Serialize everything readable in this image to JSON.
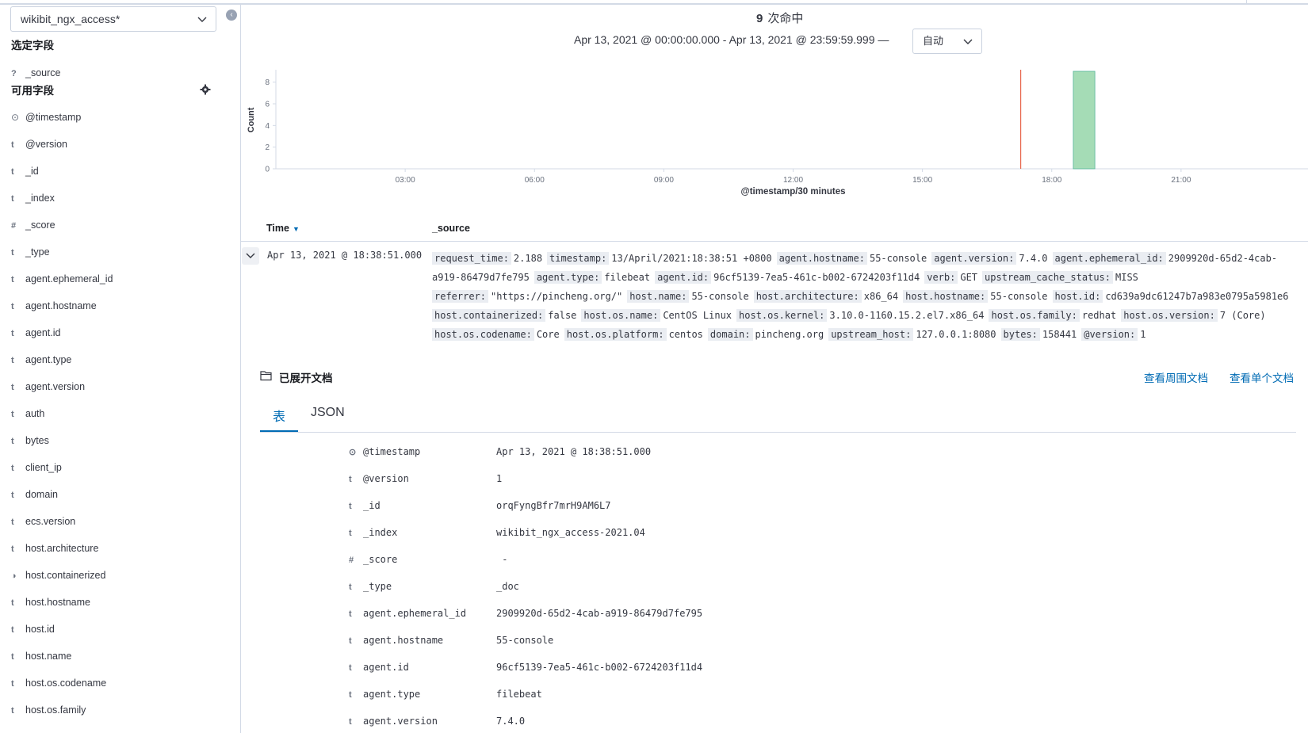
{
  "sidebar": {
    "index_pattern": "wikibit_ngx_access*",
    "collapse_icon": "chevron-left-circle-icon",
    "selected_title": "选定字段",
    "selected_fields": [
      {
        "icon": "?",
        "name": "_source"
      }
    ],
    "available_title": "可用字段",
    "fields": [
      {
        "icon": "⊙",
        "name": "@timestamp"
      },
      {
        "icon": "t",
        "name": "@version"
      },
      {
        "icon": "t",
        "name": "_id"
      },
      {
        "icon": "t",
        "name": "_index"
      },
      {
        "icon": "#",
        "name": "_score"
      },
      {
        "icon": "t",
        "name": "_type"
      },
      {
        "icon": "t",
        "name": "agent.ephemeral_id"
      },
      {
        "icon": "t",
        "name": "agent.hostname"
      },
      {
        "icon": "t",
        "name": "agent.id"
      },
      {
        "icon": "t",
        "name": "agent.type"
      },
      {
        "icon": "t",
        "name": "agent.version"
      },
      {
        "icon": "t",
        "name": "auth"
      },
      {
        "icon": "t",
        "name": "bytes"
      },
      {
        "icon": "t",
        "name": "client_ip"
      },
      {
        "icon": "t",
        "name": "domain"
      },
      {
        "icon": "t",
        "name": "ecs.version"
      },
      {
        "icon": "t",
        "name": "host.architecture"
      },
      {
        "icon": "◑",
        "name": "host.containerized"
      },
      {
        "icon": "t",
        "name": "host.hostname"
      },
      {
        "icon": "t",
        "name": "host.id"
      },
      {
        "icon": "t",
        "name": "host.name"
      },
      {
        "icon": "t",
        "name": "host.os.codename"
      },
      {
        "icon": "t",
        "name": "host.os.family"
      }
    ]
  },
  "header": {
    "hit_count": "9",
    "hit_label": "次命中",
    "time_range": "Apr 13, 2021 @ 00:00:00.000 - Apr 13, 2021 @ 23:59:59.999 —",
    "interval": "自动"
  },
  "chart_data": {
    "type": "bar",
    "ylabel": "Count",
    "xlabel": "@timestamp/30 minutes",
    "ylim": [
      0,
      9
    ],
    "y_ticks": [
      "0",
      "2",
      "4",
      "6",
      "8"
    ],
    "x_ticks": [
      "03:00",
      "06:00",
      "09:00",
      "12:00",
      "15:00",
      "18:00",
      "21:00"
    ],
    "x_range_hours": [
      0,
      24
    ],
    "bars": [
      {
        "start_hour": 18.5,
        "end_hour": 19.0,
        "count": 9
      }
    ],
    "current_time_hour": 17.28,
    "bar_color": "#a5dcb6",
    "bar_stroke": "#54b399",
    "marker_color": "#e7664c"
  },
  "table": {
    "time_header": "Time",
    "source_header": "_source",
    "row": {
      "time": "Apr 13, 2021 @ 18:38:51.000",
      "source_lines": [
        [
          [
            "request_time:",
            "2.188"
          ],
          [
            "timestamp:",
            "13/April/2021:18:38:51 +0800"
          ],
          [
            "agent.hostname:",
            "55-console"
          ],
          [
            "agent.version:",
            "7.4.0"
          ],
          [
            "agent.ephemeral_id:",
            "2909920d-65d2-4cab-"
          ]
        ],
        [
          [
            "",
            "a919-86479d7fe795"
          ],
          [
            "agent.type:",
            "filebeat"
          ],
          [
            "agent.id:",
            "96cf5139-7ea5-461c-b002-6724203f11d4"
          ],
          [
            "verb:",
            "GET"
          ],
          [
            "upstream_cache_status:",
            "MISS"
          ]
        ],
        [
          [
            "referrer:",
            "\"https://pincheng.org/\""
          ],
          [
            "host.name:",
            "55-console"
          ],
          [
            "host.architecture:",
            "x86_64"
          ],
          [
            "host.hostname:",
            "55-console"
          ],
          [
            "host.id:",
            "cd639a9dc61247b7a983e0795a5981e6"
          ]
        ],
        [
          [
            "host.containerized:",
            "false"
          ],
          [
            "host.os.name:",
            "CentOS Linux"
          ],
          [
            "host.os.kernel:",
            "3.10.0-1160.15.2.el7.x86_64"
          ],
          [
            "host.os.family:",
            "redhat"
          ],
          [
            "host.os.version:",
            "7 (Core)"
          ]
        ],
        [
          [
            "host.os.codename:",
            "Core"
          ],
          [
            "host.os.platform:",
            "centos"
          ],
          [
            "domain:",
            "pincheng.org"
          ],
          [
            "upstream_host:",
            "127.0.0.1:8080"
          ],
          [
            "bytes:",
            "158441"
          ],
          [
            "@version:",
            "1"
          ]
        ]
      ]
    }
  },
  "doc": {
    "title": "已展开文档",
    "link_surrounding": "查看周围文档",
    "link_single": "查看单个文档",
    "tab_table": "表",
    "tab_json": "JSON",
    "rows": [
      {
        "icon": "⊙",
        "name": "@timestamp",
        "value": "Apr 13, 2021 @ 18:38:51.000"
      },
      {
        "icon": "t",
        "name": "@version",
        "value": "1"
      },
      {
        "icon": "t",
        "name": "_id",
        "value": "orqFyngBfr7mrH9AM6L7"
      },
      {
        "icon": "t",
        "name": "_index",
        "value": "wikibit_ngx_access-2021.04"
      },
      {
        "icon": "#",
        "name": "_score",
        "value": " -"
      },
      {
        "icon": "t",
        "name": "_type",
        "value": "_doc"
      },
      {
        "icon": "t",
        "name": "agent.ephemeral_id",
        "value": "2909920d-65d2-4cab-a919-86479d7fe795"
      },
      {
        "icon": "t",
        "name": "agent.hostname",
        "value": "55-console"
      },
      {
        "icon": "t",
        "name": "agent.id",
        "value": "96cf5139-7ea5-461c-b002-6724203f11d4"
      },
      {
        "icon": "t",
        "name": "agent.type",
        "value": "filebeat"
      },
      {
        "icon": "t",
        "name": "agent.version",
        "value": "7.4.0"
      }
    ]
  }
}
